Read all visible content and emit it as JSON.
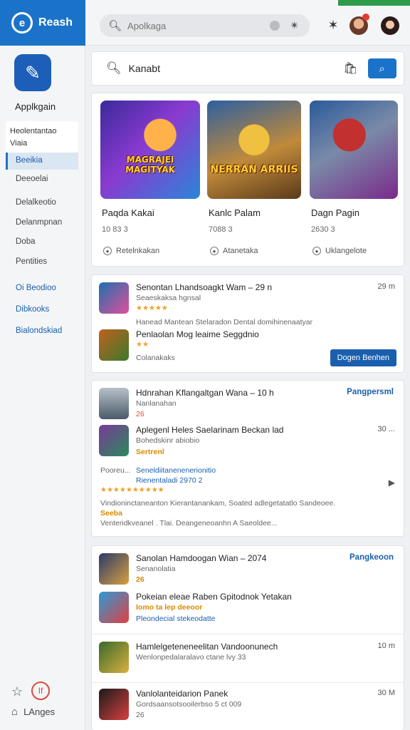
{
  "topbar": {
    "brand_logo": "e",
    "brand_name": "Reash",
    "search_placeholder": "Apolkaga",
    "pin_icon": "pin-icon",
    "avatar_badge_color": "#e53935"
  },
  "sidebar": {
    "app_name": "Applkgain",
    "card_line1": "Heolentantao",
    "card_line2": "Viaia",
    "items": [
      "Beeikia",
      "Deeoelai",
      "Delalkeotio",
      "Delanmpnan",
      "Doba",
      "Pentities"
    ],
    "links": [
      "Oi Beodioo",
      "Dibkooks",
      "Bialondskiad"
    ],
    "footer_badge": "If",
    "language": "LAnges"
  },
  "search": {
    "value": "Kanabt"
  },
  "featured": [
    {
      "name": "Paqda Kakai",
      "stat": "10 83 3",
      "tag": "Retelnkakan",
      "caption": "MAGRAJEI MAGITYAK"
    },
    {
      "name": "Kanlc Palam",
      "stat": "7088 3",
      "tag": "Atanetaka",
      "caption": "NERRAN ARRIIS"
    },
    {
      "name": "Dagn Pagin",
      "stat": "2630 3",
      "tag": "Uklangelote",
      "caption": ""
    }
  ],
  "section1": {
    "row1": {
      "title": "Senontan Lhandsoagkt Wam – 29 n",
      "sub": "Seaeskaksa hgnsal",
      "meta": "29 m",
      "stars": "★★★★★"
    },
    "row2": {
      "line1": "Hanead Mantean Stelaradon Dental domihinenaatyar",
      "title": "Penlaolan Mog leaime Seggdnio",
      "stars": "★★",
      "extra": "Colanakaks"
    },
    "button": "Dogen Benhen"
  },
  "section2": {
    "row1": {
      "title": "Hdnrahan Kflangaltgan Wana – 10 h",
      "sub": "Nanlanahan",
      "num": "26",
      "link": "Pangpersml"
    },
    "row2": {
      "title": "Aplegenl Heles Saelarinam Beckan lad",
      "sub": "Bohedskinr abiobio",
      "sub2": "Sertrenl",
      "meta": "30 ..."
    },
    "row3": {
      "left": "Pooreu...",
      "blue1": "Seneldiitanenenerionitio",
      "blue2": "Rienentaladi 2970 2",
      "stars": "★★★★★★★★★★",
      "line": "Vindioninctaneanton Kierantanankam, Soated adlegetatatlo Sandeoee.",
      "gold": "Seeba",
      "line2": "Venteridkveanel . Tlai. Deangeneoanhn A Saeoldee..."
    }
  },
  "section3": {
    "row1": {
      "title": "Sanolan Hamdoogan Wian – 2074",
      "sub": "Senanolatia",
      "num": "26",
      "link": "Pangkeoon"
    },
    "row2": {
      "title": "Pokeian eleae Raben Gpitodnok Yetakan",
      "gold": "Iomo ta lep deeoor",
      "sub": "Pleondecial stekeodatte"
    },
    "row3": {
      "title": "Hamlelgeteneneelitan Vandoonunech",
      "sub": "Wenlonpedalaralavo ctane lvy 33",
      "meta": "10 m"
    },
    "row4": {
      "title": "Vanlolanteidarion Panek",
      "sub": "Gordsaansotsooilerbso 5 ct 009",
      "num": "26",
      "meta": "30 M"
    }
  }
}
